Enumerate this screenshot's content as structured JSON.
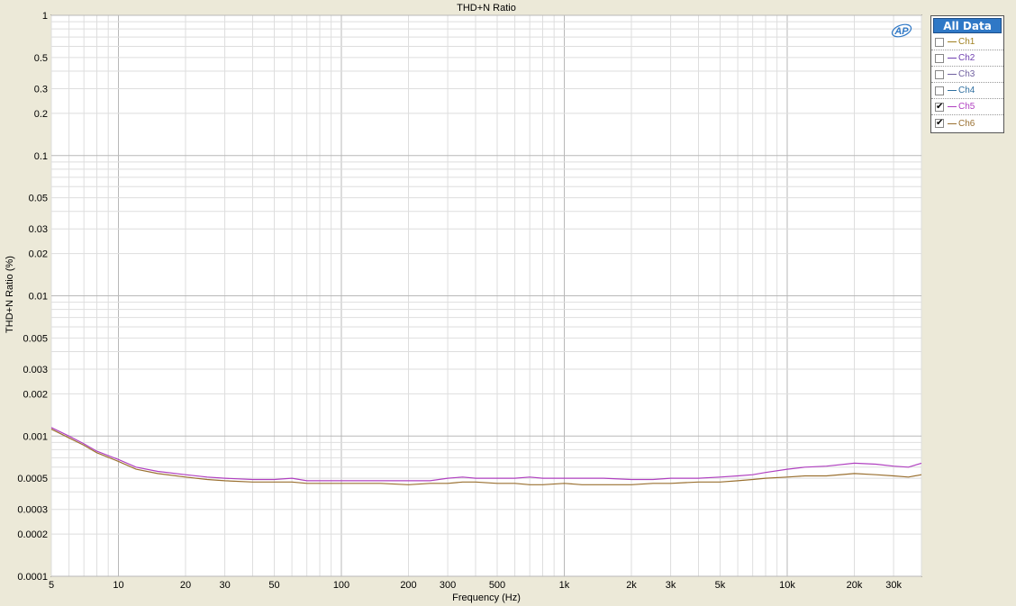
{
  "chart_data": {
    "type": "line",
    "title": "THD+N Ratio",
    "xlabel": "Frequency (Hz)",
    "ylabel": "THD+N Ratio (%)",
    "xscale": "log",
    "yscale": "log",
    "xlim": [
      5,
      40000
    ],
    "ylim": [
      0.0001,
      1
    ],
    "grid": true,
    "xticks": [
      5,
      10,
      20,
      30,
      50,
      100,
      200,
      300,
      500,
      1000,
      2000,
      3000,
      5000,
      10000,
      20000,
      30000
    ],
    "xtick_labels": [
      "5",
      "10",
      "20",
      "30",
      "50",
      "100",
      "200",
      "300",
      "500",
      "1k",
      "2k",
      "3k",
      "5k",
      "10k",
      "20k",
      "30k"
    ],
    "yticks": [
      1,
      0.5,
      0.3,
      0.2,
      0.1,
      0.05,
      0.03,
      0.02,
      0.01,
      0.005,
      0.003,
      0.002,
      0.001,
      0.0005,
      0.0003,
      0.0002,
      0.0001
    ],
    "ytick_labels": [
      "1",
      "0.5",
      "0.3",
      "0.2",
      "0.1",
      "0.05",
      "0.03",
      "0.02",
      "0.01",
      "0.005",
      "0.003",
      "0.002",
      "0.001",
      "0.0005",
      "0.0003",
      "0.0002",
      "0.0001"
    ],
    "series": [
      {
        "name": "Ch5",
        "color": "#b040c0",
        "x": [
          5,
          6,
          7,
          8,
          10,
          12,
          15,
          20,
          25,
          30,
          40,
          50,
          60,
          70,
          80,
          100,
          120,
          150,
          200,
          250,
          300,
          350,
          400,
          500,
          600,
          700,
          800,
          1000,
          1200,
          1500,
          2000,
          2500,
          3000,
          4000,
          5000,
          6000,
          7000,
          8000,
          10000,
          12000,
          15000,
          20000,
          25000,
          30000,
          35000,
          40000
        ],
        "y": [
          0.00115,
          0.001,
          0.00088,
          0.00078,
          0.00068,
          0.0006,
          0.00056,
          0.00053,
          0.00051,
          0.0005,
          0.00049,
          0.00049,
          0.0005,
          0.00048,
          0.00048,
          0.00048,
          0.00048,
          0.00048,
          0.00048,
          0.00048,
          0.0005,
          0.00051,
          0.0005,
          0.0005,
          0.0005,
          0.00051,
          0.0005,
          0.0005,
          0.0005,
          0.0005,
          0.00049,
          0.00049,
          0.0005,
          0.0005,
          0.00051,
          0.00052,
          0.00053,
          0.00055,
          0.00058,
          0.0006,
          0.00061,
          0.00064,
          0.00063,
          0.00061,
          0.0006,
          0.00064
        ]
      },
      {
        "name": "Ch6",
        "color": "#9a7030",
        "x": [
          5,
          6,
          7,
          8,
          10,
          12,
          15,
          20,
          25,
          30,
          40,
          50,
          60,
          70,
          80,
          100,
          120,
          150,
          200,
          250,
          300,
          350,
          400,
          500,
          600,
          700,
          800,
          1000,
          1200,
          1500,
          2000,
          2500,
          3000,
          4000,
          5000,
          6000,
          7000,
          8000,
          10000,
          12000,
          15000,
          20000,
          25000,
          30000,
          35000,
          40000
        ],
        "y": [
          0.00112,
          0.00097,
          0.00086,
          0.00076,
          0.00066,
          0.00058,
          0.00054,
          0.00051,
          0.00049,
          0.00048,
          0.00047,
          0.00047,
          0.00047,
          0.00046,
          0.00046,
          0.00046,
          0.00046,
          0.00046,
          0.00045,
          0.00046,
          0.00046,
          0.00047,
          0.00047,
          0.00046,
          0.00046,
          0.00045,
          0.00045,
          0.00046,
          0.00045,
          0.00045,
          0.00045,
          0.00046,
          0.00046,
          0.00047,
          0.00047,
          0.00048,
          0.00049,
          0.0005,
          0.00051,
          0.00052,
          0.00052,
          0.00054,
          0.00053,
          0.00052,
          0.00051,
          0.00053
        ]
      }
    ]
  },
  "legend": {
    "header": "All Data",
    "items": [
      {
        "label": "Ch1",
        "checked": false,
        "color": "#a08020"
      },
      {
        "label": "Ch2",
        "checked": false,
        "color": "#7040b0"
      },
      {
        "label": "Ch3",
        "checked": false,
        "color": "#7060a0"
      },
      {
        "label": "Ch4",
        "checked": false,
        "color": "#3070a0"
      },
      {
        "label": "Ch5",
        "checked": true,
        "color": "#b040c0"
      },
      {
        "label": "Ch6",
        "checked": true,
        "color": "#9a7030"
      }
    ]
  },
  "logo": "AP"
}
